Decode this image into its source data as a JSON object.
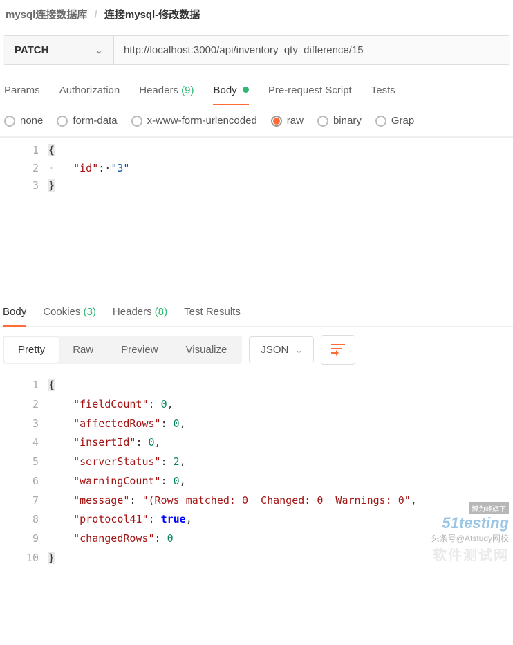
{
  "breadcrumb": {
    "parent": "mysql连接数据库",
    "sep": "/",
    "current": "连接mysql-修改数据"
  },
  "request": {
    "method": "PATCH",
    "url": "http://localhost:3000/api/inventory_qty_difference/15"
  },
  "tabs": {
    "params": "Params",
    "auth": "Authorization",
    "headers": "Headers",
    "headers_count": "(9)",
    "body": "Body",
    "prereq": "Pre-request Script",
    "tests": "Tests"
  },
  "body_types": {
    "none": "none",
    "formdata": "form-data",
    "urlencoded": "x-www-form-urlencoded",
    "raw": "raw",
    "binary": "binary",
    "graphql": "Grap"
  },
  "req_body": {
    "l1": "{",
    "l2_key": "\"id\"",
    "l2_sep": ":·",
    "l2_val": "\"3\"",
    "l3": "}"
  },
  "resp_tabs": {
    "body": "Body",
    "cookies": "Cookies",
    "cookies_count": "(3)",
    "headers": "Headers",
    "headers_count": "(8)",
    "tests": "Test Results"
  },
  "view_tabs": {
    "pretty": "Pretty",
    "raw": "Raw",
    "preview": "Preview",
    "visualize": "Visualize"
  },
  "format_dd": "JSON",
  "response": {
    "lines": [
      {
        "n": "1",
        "raw": "{"
      },
      {
        "n": "2",
        "k": "\"fieldCount\"",
        "v": "0",
        "t": "num",
        "c": ","
      },
      {
        "n": "3",
        "k": "\"affectedRows\"",
        "v": "0",
        "t": "num",
        "c": ","
      },
      {
        "n": "4",
        "k": "\"insertId\"",
        "v": "0",
        "t": "num",
        "c": ","
      },
      {
        "n": "5",
        "k": "\"serverStatus\"",
        "v": "2",
        "t": "num",
        "c": ","
      },
      {
        "n": "6",
        "k": "\"warningCount\"",
        "v": "0",
        "t": "num",
        "c": ","
      },
      {
        "n": "7",
        "k": "\"message\"",
        "v": "\"(Rows matched: 0  Changed: 0  Warnings: 0\"",
        "t": "str",
        "c": ","
      },
      {
        "n": "8",
        "k": "\"protocol41\"",
        "v": "true",
        "t": "bool",
        "c": ","
      },
      {
        "n": "9",
        "k": "\"changedRows\"",
        "v": "0",
        "t": "num",
        "c": ""
      },
      {
        "n": "10",
        "raw": "}"
      }
    ]
  },
  "watermark": {
    "l1": "博为峰旗下",
    "l2a": "51",
    "l2b": "testing",
    "l3": "头条号@Atstudy网校",
    "l4": "软件测试网"
  }
}
